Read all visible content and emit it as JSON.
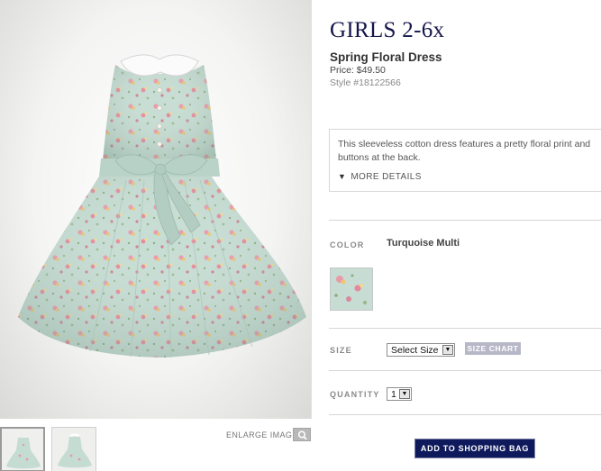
{
  "product": {
    "category": "GIRLS 2-6x",
    "name": "Spring Floral Dress",
    "price": "Price: $49.50",
    "style": "Style #18122566",
    "description": "This sleeveless cotton dress features a pretty floral print and buttons at the back.",
    "more_details": "MORE DETAILS"
  },
  "gallery": {
    "enlarge_label": "ENLARGE IMAGE",
    "thumbnail_count": 2,
    "active_thumbnail": 1
  },
  "options": {
    "color_label": "COLOR",
    "color_value": "Turquoise Multi",
    "size_label": "SIZE",
    "size_selected": "Select Size",
    "size_chart": "SIZE CHART",
    "quantity_label": "QUANTITY",
    "quantity_selected": "1"
  },
  "cta": {
    "add_to_bag": "ADD TO SHOPPING BAG"
  },
  "colors": {
    "heading_navy": "#15154a",
    "button_navy": "#0e1a5c",
    "dress_mint": "#c4dcd2",
    "size_chart_bg": "#b6b8c7"
  },
  "icons": {
    "more_details": "triangle-down-icon",
    "enlarge": "magnifier-icon",
    "select_arrow": "caret-down-icon"
  }
}
